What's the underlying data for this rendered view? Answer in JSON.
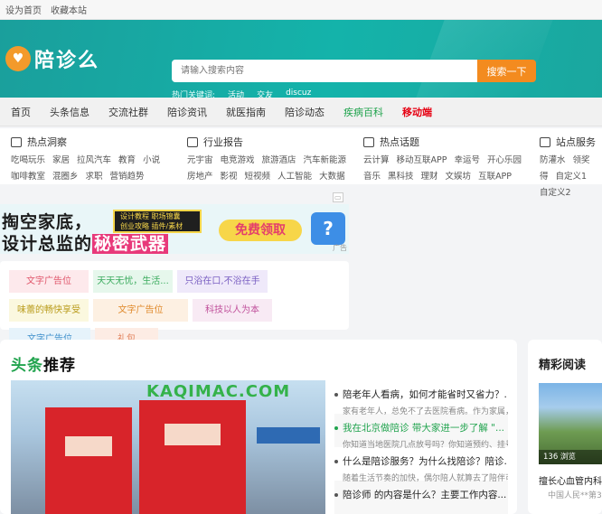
{
  "topbar": {
    "set_home": "设为首页",
    "bookmark": "收藏本站"
  },
  "header": {
    "logo_text": "陪诊么",
    "search_placeholder": "请输入搜索内容",
    "search_button": "搜索一下",
    "hot_label": "热门关键词:",
    "hot_words": [
      "活动",
      "交友",
      "discuz"
    ]
  },
  "nav": [
    "首页",
    "头条信息",
    "交流社群",
    "陪诊资讯",
    "就医指南",
    "陪诊动态",
    "疾病百科",
    "移动端"
  ],
  "categories": [
    {
      "title": "热点洞察",
      "links": [
        "吃喝玩乐",
        "家居",
        "拉风汽车",
        "教育",
        "小说",
        "咖啡教室",
        "混圈乡",
        "求职",
        "营销趋势"
      ]
    },
    {
      "title": "行业报告",
      "links": [
        "元宇宙",
        "电竞游戏",
        "旅游酒店",
        "汽车新能源",
        "房地产",
        "影视",
        "短视频",
        "人工智能",
        "大数据"
      ]
    },
    {
      "title": "热点话题",
      "links": [
        "云计算",
        "移动互联APP",
        "幸运号",
        "开心乐园",
        "音乐",
        "黑科技",
        "理财",
        "文娱坊",
        "互联APP"
      ]
    },
    {
      "title": "站点服务",
      "links": [
        "防灌水",
        "领奖",
        "得",
        "自定义1",
        "自定义2"
      ]
    }
  ],
  "ad_banner": {
    "line1": "掏空家底，",
    "line2_prefix": "设计总监的",
    "line2_highlight": "秘密武器",
    "tag_line1": "设计教程  职场锦囊",
    "tag_line2": "创业攻略  插件/素材",
    "cta": "免费领取",
    "mark": "广告"
  },
  "text_ads": [
    "文字广告位",
    "天天无忧，生活...",
    "只浴在口,不浴在手",
    "味蕾的畅快享受",
    "文字广告位",
    "科技以人为本",
    "文字广告位",
    "礼包"
  ],
  "headlines": {
    "title_green": "头条",
    "title_rest": "推荐",
    "image_watermark": "KAQIMAC.COM",
    "items": [
      {
        "title": "陪老年人看病，如何才能省时又省力？...",
        "sub": "家有老年人，总免不了去医院看病。作为家属，你...",
        "highlight": false
      },
      {
        "title": "我在北京做陪诊 带大家进一步了解 \"...",
        "sub": "你知道当地医院几点放号吗？你知道预约、挂号...",
        "highlight": true
      },
      {
        "title": "什么是陪诊服务？为什么找陪诊？陪诊...",
        "sub": "随着生活节奏的加快，偶尔陪人就算去了陪伴可能会...",
        "highlight": false
      },
      {
        "title": "陪诊师 的内容是什么？主要工作内容...",
        "sub": "",
        "highlight": false
      }
    ]
  },
  "side": {
    "title": "精彩阅读",
    "views": "136 浏览",
    "news_title": "擅长心血管内科...",
    "news_source": "中国人民**第30..."
  },
  "colors": {
    "teal": "#14b3aa",
    "orange": "#f38b1f",
    "green": "#20a34d",
    "red": "#e60012"
  }
}
